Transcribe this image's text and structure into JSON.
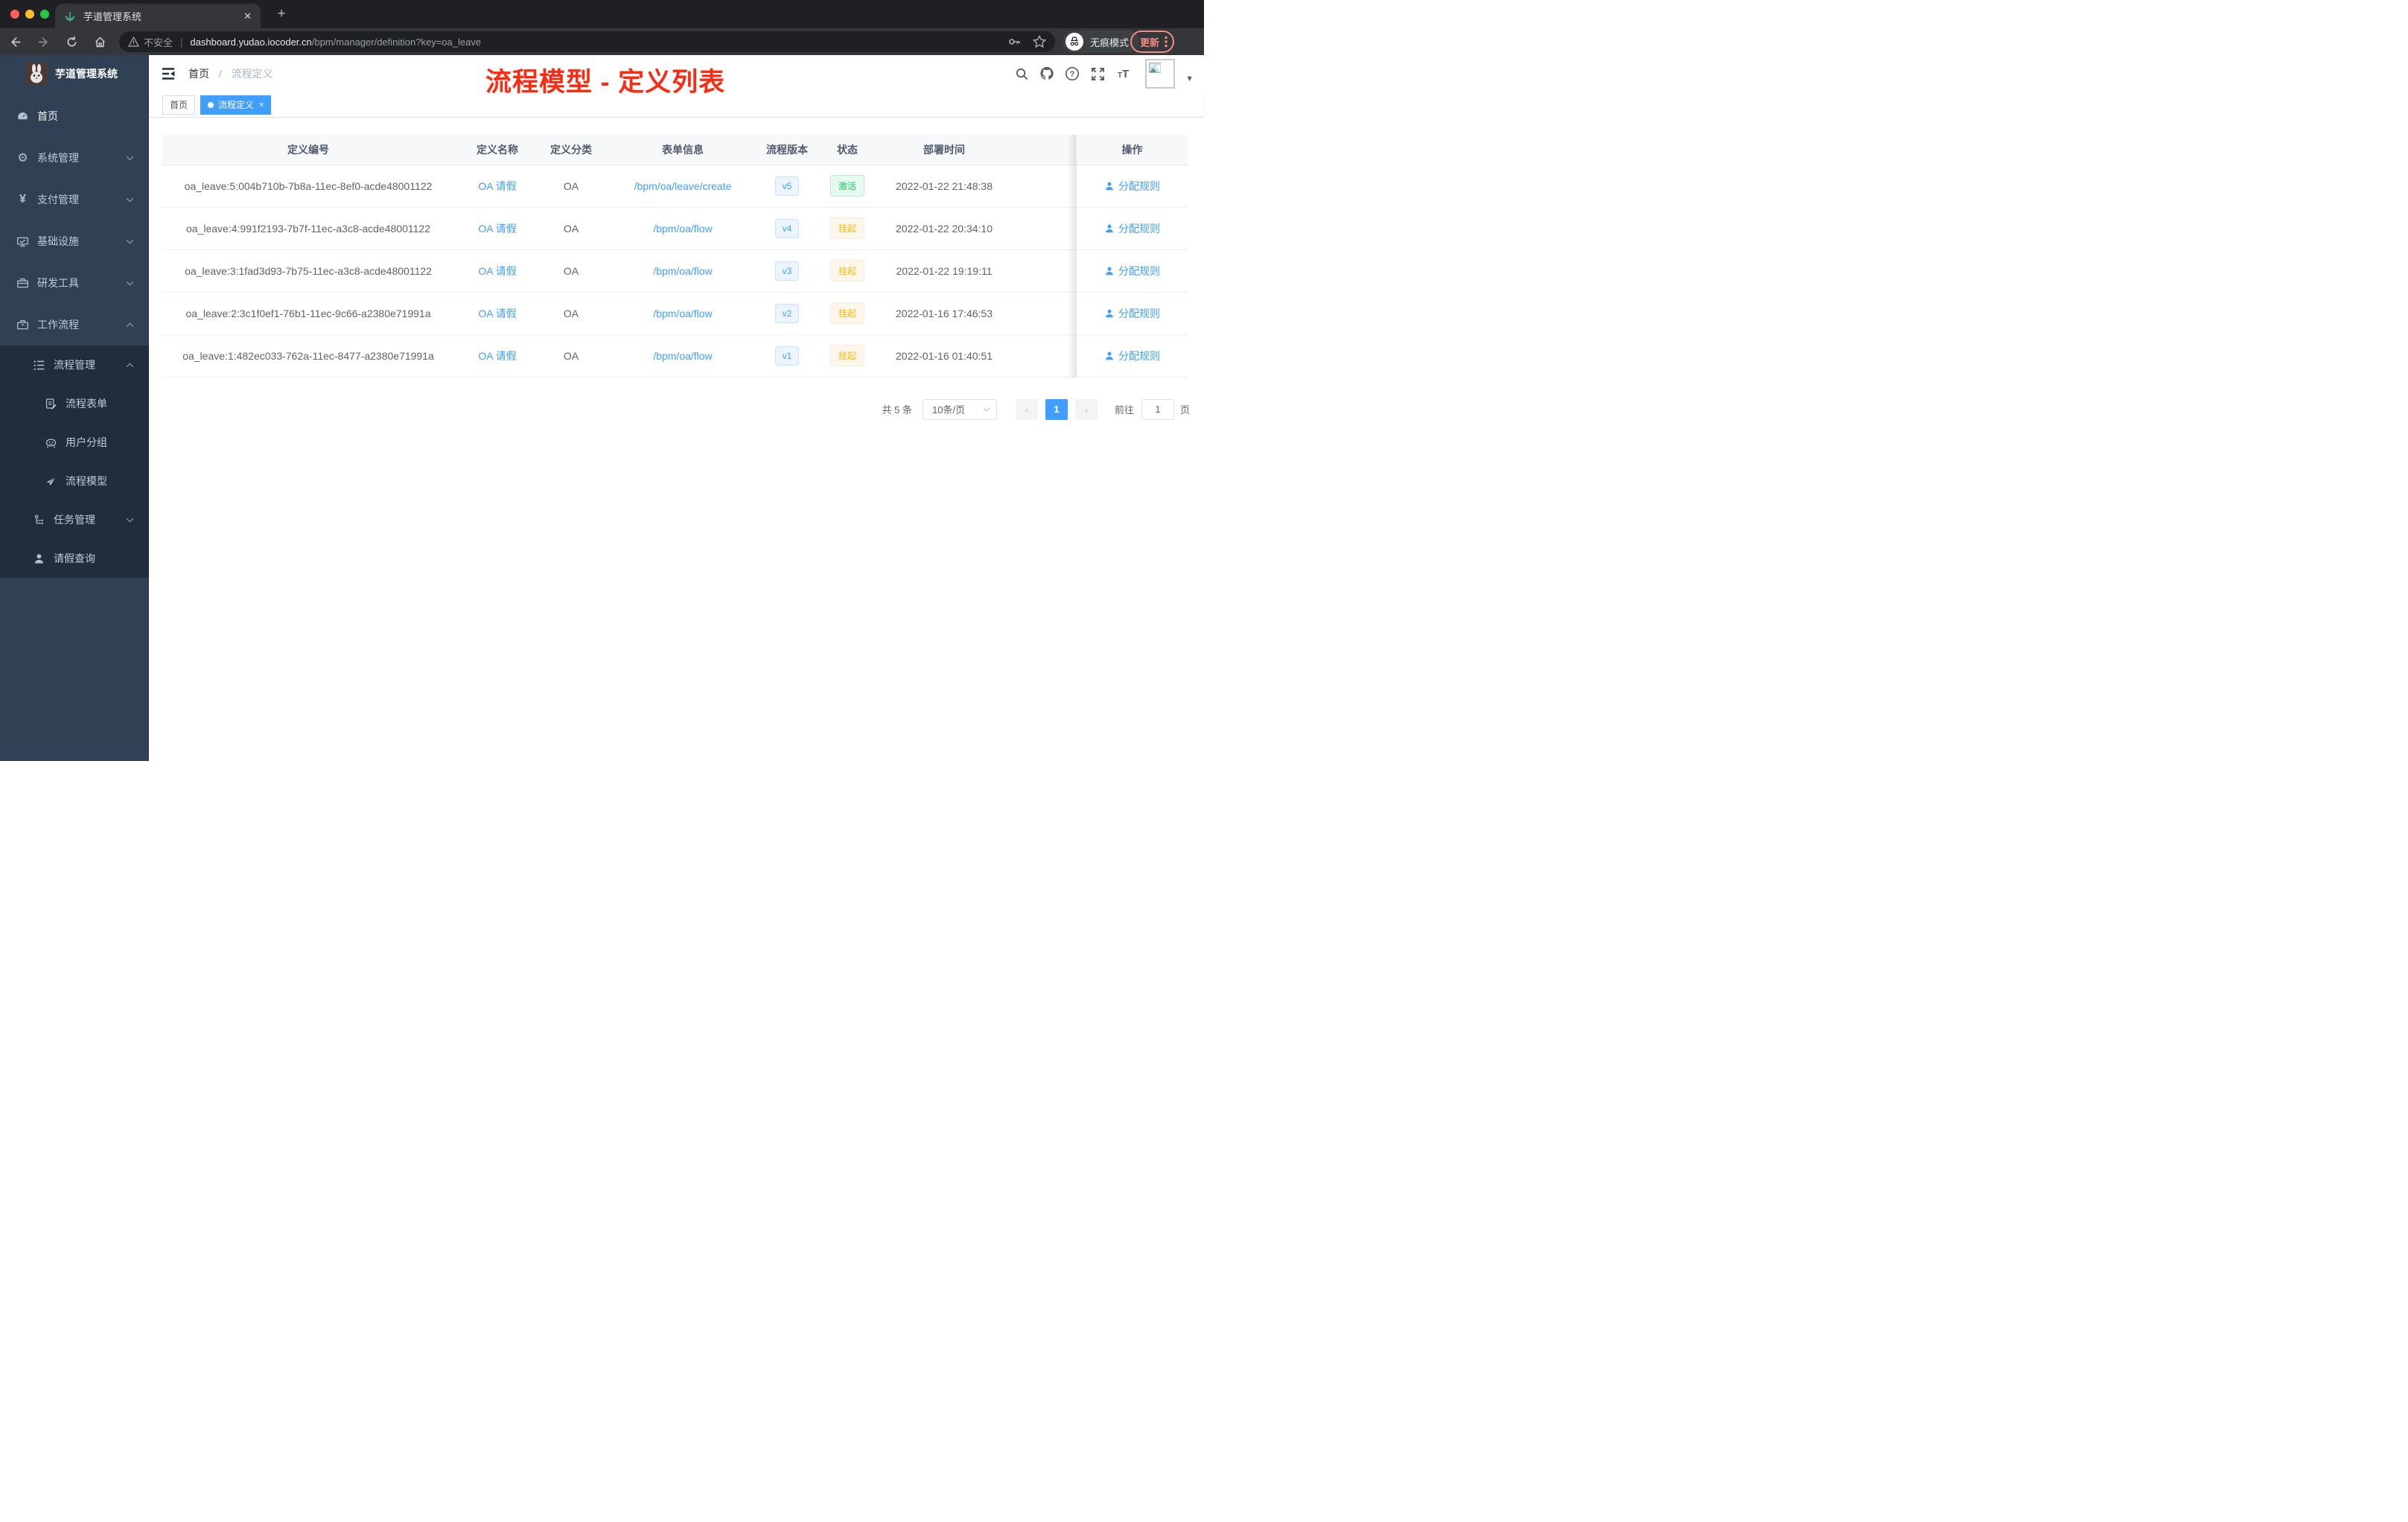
{
  "browser": {
    "tab_title": "芋道管理系统",
    "insecure_label": "不安全",
    "url_host": "dashboard.yudao.iocoder.cn",
    "url_path": "/bpm/manager/definition?key=oa_leave",
    "incognito_label": "无痕模式",
    "update_label": "更新"
  },
  "sidebar": {
    "title": "芋道管理系统",
    "menu": [
      {
        "label": "首页"
      },
      {
        "label": "系统管理"
      },
      {
        "label": "支付管理"
      },
      {
        "label": "基础设施"
      },
      {
        "label": "研发工具"
      },
      {
        "label": "工作流程"
      }
    ],
    "submenu": [
      {
        "label": "流程管理"
      },
      {
        "label": "流程表单"
      },
      {
        "label": "用户分组"
      },
      {
        "label": "流程模型"
      },
      {
        "label": "任务管理"
      },
      {
        "label": "请假查询"
      }
    ]
  },
  "header": {
    "breadcrumb_home": "首页",
    "breadcrumb_sep": "/",
    "breadcrumb_current": "流程定义",
    "annotation": "流程模型 - 定义列表"
  },
  "tags": {
    "home": "首页",
    "active": "流程定义",
    "close": "×"
  },
  "table": {
    "columns": [
      "定义编号",
      "定义名称",
      "定义分类",
      "表单信息",
      "流程版本",
      "状态",
      "部署时间",
      "操作"
    ],
    "action_label": "分配规则",
    "rows": [
      {
        "id": "oa_leave:5:004b710b-7b8a-11ec-8ef0-acde48001122",
        "name": "OA 请假",
        "category": "OA",
        "form": "/bpm/oa/leave/create",
        "version": "v5",
        "status": "激活",
        "time": "2022-01-22 21:48:38"
      },
      {
        "id": "oa_leave:4:991f2193-7b7f-11ec-a3c8-acde48001122",
        "name": "OA 请假",
        "category": "OA",
        "form": "/bpm/oa/flow",
        "version": "v4",
        "status": "挂起",
        "time": "2022-01-22 20:34:10"
      },
      {
        "id": "oa_leave:3:1fad3d93-7b75-11ec-a3c8-acde48001122",
        "name": "OA 请假",
        "category": "OA",
        "form": "/bpm/oa/flow",
        "version": "v3",
        "status": "挂起",
        "time": "2022-01-22 19:19:11"
      },
      {
        "id": "oa_leave:2:3c1f0ef1-76b1-11ec-9c66-a2380e71991a",
        "name": "OA 请假",
        "category": "OA",
        "form": "/bpm/oa/flow",
        "version": "v2",
        "status": "挂起",
        "time": "2022-01-16 17:46:53"
      },
      {
        "id": "oa_leave:1:482ec033-762a-11ec-8477-a2380e71991a",
        "name": "OA 请假",
        "category": "OA",
        "form": "/bpm/oa/flow",
        "version": "v1",
        "status": "挂起",
        "time": "2022-01-16 01:40:51"
      }
    ]
  },
  "pagination": {
    "total": "共 5 条",
    "page_size": "10条/页",
    "prev": "‹",
    "page": "1",
    "next": "›",
    "goto_label": "前往",
    "goto_value": "1",
    "unit_label": "页"
  },
  "colors": {
    "accent": "#409eff",
    "success": "#13ce66",
    "warning": "#ffba00",
    "annotation_red": "#fb2a10",
    "sidebar_bg": "#304156",
    "submenu_bg": "#1f2d3d",
    "chrome_update": "#f28b82"
  }
}
